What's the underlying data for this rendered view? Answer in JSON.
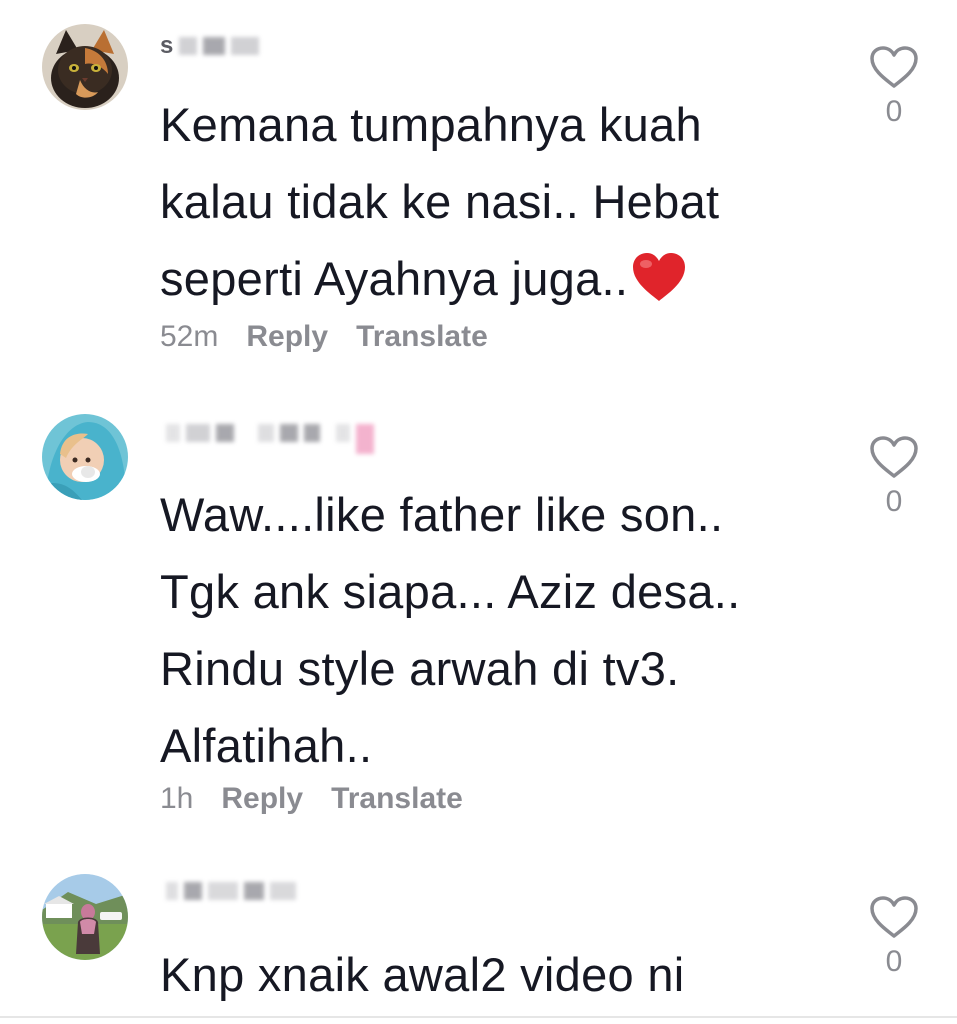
{
  "comments": [
    {
      "avatar_icon": "cat-avatar",
      "username": "s",
      "lines": [
        "Kemana tumpahnya kuah",
        "kalau tidak ke nasi.. Hebat",
        "seperti Ayahnya juga.."
      ],
      "emoji": "red-heart-emoji",
      "time": "52m",
      "reply_label": "Reply",
      "translate_label": "Translate",
      "like_count": "0"
    },
    {
      "avatar_icon": "child-in-hoodie-avatar",
      "username": "",
      "lines": [
        "Waw....like father like son..",
        "Tgk ank siapa... Aziz desa..",
        "Rindu style arwah di tv3.",
        "Alfatihah.."
      ],
      "time": "1h",
      "reply_label": "Reply",
      "translate_label": "Translate",
      "like_count": "0"
    },
    {
      "avatar_icon": "outdoor-person-avatar",
      "username": "",
      "lines": [
        "Knp xnaik awal2 video ni"
      ],
      "like_count": "0"
    }
  ],
  "colors": {
    "text": "#161823",
    "meta": "#8a8b91",
    "heart_emoji": "#e0242b"
  }
}
